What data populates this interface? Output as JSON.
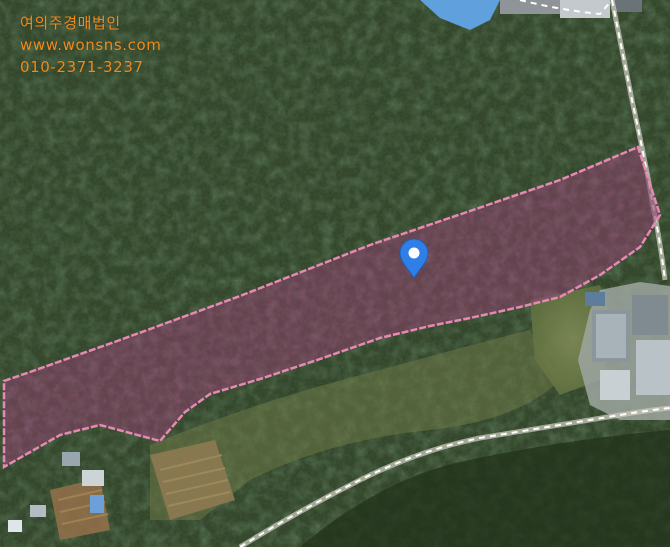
{
  "map": {
    "type": "satellite-parcel-view",
    "parcel_outline_color": "#e889b4",
    "parcel_fill_color": "#8a3f6a",
    "marker_color": "#2f7fe6",
    "marker_icon": "location-pin-icon"
  },
  "watermark": {
    "company": "여의주경매법인",
    "website": "www.wonsns.com",
    "phone": "010-2371-3237",
    "color": "#f08a1c"
  }
}
